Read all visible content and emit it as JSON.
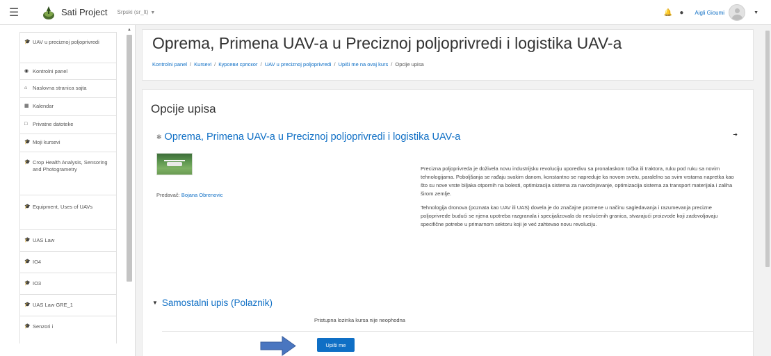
{
  "navbar": {
    "site_name": "Sati Project",
    "language": "Srpski (sr_lt)",
    "username": "Aigli Gioumi"
  },
  "drawer": {
    "items": [
      {
        "label": "UAV u preciznoj poljoprivredi",
        "icon": "graduation-cap-icon"
      },
      {
        "label": "Kontrolni panel",
        "icon": "dashboard-icon"
      },
      {
        "label": "Naslovna stranica sajta",
        "icon": "home-icon"
      },
      {
        "label": "Kalendar",
        "icon": "calendar-icon"
      },
      {
        "label": "Privatne datoteke",
        "icon": "file-icon"
      },
      {
        "label": "Moji kursevi",
        "icon": "graduation-cap-icon"
      },
      {
        "label": "Crop Health Analysis, Sensoring and Photogrametry",
        "icon": "graduation-cap-icon"
      },
      {
        "label": "Equipment, Uses of UAVs",
        "icon": "graduation-cap-icon"
      },
      {
        "label": "UAS Law",
        "icon": "graduation-cap-icon"
      },
      {
        "label": "IO4",
        "icon": "graduation-cap-icon"
      },
      {
        "label": "IO3",
        "icon": "graduation-cap-icon"
      },
      {
        "label": "UAS Law GRE_1",
        "icon": "graduation-cap-icon"
      },
      {
        "label": "Senzori i",
        "icon": "graduation-cap-icon"
      }
    ]
  },
  "header": {
    "title": "Oprema, Primena UAV-a u Preciznoj poljoprivredi i logistika UAV-a",
    "breadcrumb": [
      "Kontrolni panel",
      "Kursevi",
      "Курсеви српског",
      "UAV u preciznoj poljoprivredi",
      "Upiši me na ovaj kurs",
      "Opcije upisa"
    ]
  },
  "main": {
    "section_title": "Opcije upisa",
    "course_name": "Oprema, Primena UAV-a u Preciznoj poljoprivredi i logistika UAV-a",
    "teacher_label": "Predavač:",
    "teacher_name": "Bojana Obrenovic",
    "summary_p1": "Precizna poljoprivreda je doživela novu industrijsku revoluciju uporedivu sa pronalaskom točka ili traktora, ruku pod ruku sa novim tehnologijama. Poboljšanja se rađaju svakim danom, konstantno se napreduje ka novom svetu, paralelno sa svim vrstama napretka kao što su nove vrste biljaka otpornih na bolesti, optimizacija sistema za navodnjavanje, optimizacija sistema za transport materijala i zaliha širom zemlje.",
    "summary_p2": "Tehnologija dronova (poznata kao UAV ili UAS) dovela je do značajne promene u načinu sagledavanja i razumevanja precizne poljoprivrede budući se njena upotreba razgranala i specijalizovala do neslućenih granica, stvarajući proizvode koji zadovoljavaju specifične potrebe u primarnom sektoru koji je već zahtevao novu revoluciju.",
    "self_enrol_title": "Samostalni upis (Polaznik)",
    "no_key_text": "Pristupna lozinka kursa nije neophodna",
    "enrol_button": "Upiši me"
  },
  "colors": {
    "link": "#0f6fc5",
    "button": "#0f6fc5",
    "arrow": "#4a76c0"
  }
}
